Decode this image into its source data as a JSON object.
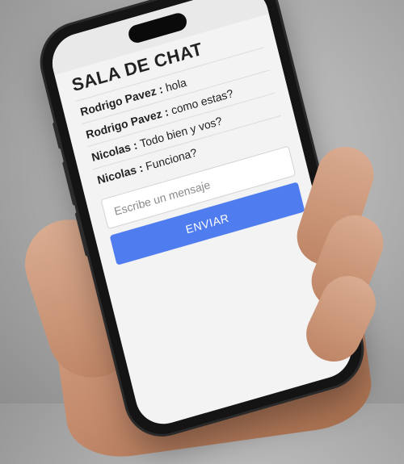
{
  "chat": {
    "title": "SALA DE CHAT",
    "messages": [
      {
        "user": "Rodrigo Pavez",
        "text": "hola"
      },
      {
        "user": "Rodrigo Pavez",
        "text": "como estas?"
      },
      {
        "user": "Nicolas",
        "text": "Todo bien y vos?"
      },
      {
        "user": "Nicolas",
        "text": "Funciona?"
      }
    ],
    "separator": " : ",
    "input_placeholder": "Escribe un mensaje",
    "input_value": "",
    "send_label": "ENVIAR"
  },
  "colors": {
    "send_button": "#4f7df0",
    "screen_background": "#f3f3f3"
  }
}
